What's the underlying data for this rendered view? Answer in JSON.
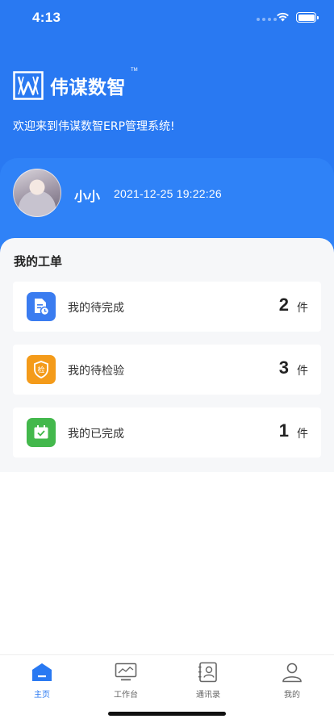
{
  "status_bar": {
    "time": "4:13"
  },
  "brand": {
    "name": "伟谋数智",
    "tm": "TM"
  },
  "welcome_text": "欢迎来到伟谋数智ERP管理系统!",
  "user": {
    "name": "小小",
    "login_time": "2021-12-25   19:22:26"
  },
  "work_orders": {
    "title": "我的工单",
    "items": [
      {
        "label": "我的待完成",
        "count": "2",
        "unit": "件",
        "icon": "document-clock-icon",
        "color": "#3a7cf0"
      },
      {
        "label": "我的待检验",
        "count": "3",
        "unit": "件",
        "icon": "inspect-badge-icon",
        "color": "#f49b1a",
        "icon_text": "检"
      },
      {
        "label": "我的已完成",
        "count": "1",
        "unit": "件",
        "icon": "calendar-check-icon",
        "color": "#43b84c"
      }
    ]
  },
  "tabbar": {
    "items": [
      {
        "label": "主页",
        "icon": "home-icon",
        "active": true
      },
      {
        "label": "工作台",
        "icon": "monitor-icon",
        "active": false
      },
      {
        "label": "通讯录",
        "icon": "contacts-icon",
        "active": false
      },
      {
        "label": "我的",
        "icon": "person-icon",
        "active": false
      }
    ]
  },
  "colors": {
    "primary": "#2979f2",
    "card_blue": "#2f82f7",
    "page_bg": "#f6f7f9"
  }
}
